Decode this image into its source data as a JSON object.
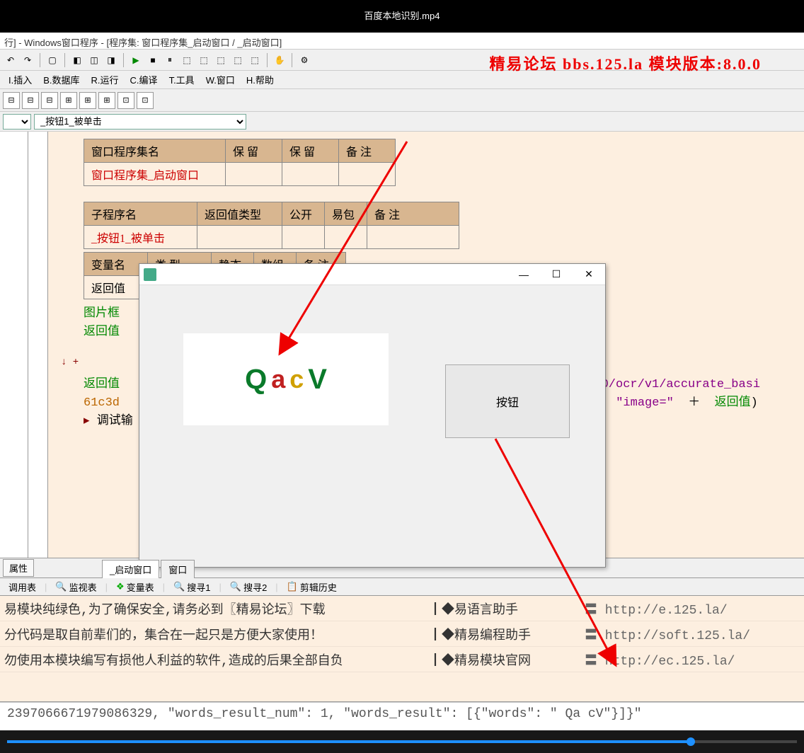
{
  "video_title": "百度本地识别.mp4",
  "window_title": "行] - Windows窗口程序 - [程序集: 窗口程序集_启动窗口 / _启动窗口]",
  "banner": "精易论坛 bbs.125.la 模块版本:8.0.0",
  "menu": {
    "insert": "I.插入",
    "database": "B.数据库",
    "run": "R.运行",
    "compile": "C.编译",
    "tools": "T.工具",
    "window": "W.窗口",
    "help": "H.帮助"
  },
  "dropdown2": "_按钮1_被单击",
  "table1": {
    "h1": "窗口程序集名",
    "h2": "保 留",
    "h3": "保 留",
    "h4": "备 注",
    "r1": "窗口程序集_启动窗口"
  },
  "table2": {
    "h1": "子程序名",
    "h2": "返回值类型",
    "h3": "公开",
    "h4": "易包",
    "h5": "备 注",
    "r1": "_按钮1_被单击"
  },
  "table3": {
    "h1": "变量名",
    "h2": "类 型",
    "h3": "静态",
    "h4": "数组",
    "h5": "备 注",
    "r1": "返回值"
  },
  "code": {
    "l1": "图片框",
    "l2": "返回值",
    "l3a": "返回值",
    "l3b": ".0/ocr/v1/accurate_basi",
    "l4a": "61c3d",
    "l4b": "\"image=\"",
    "l4c": "＋",
    "l4d": "返回值",
    "l5": "调试输"
  },
  "popup": {
    "button_label": "按钮",
    "captcha": {
      "q": "Q",
      "a": "a",
      "c": "c",
      "v": "V"
    },
    "min": "—",
    "max": "☐",
    "close": "✕"
  },
  "prop_tab": "属性",
  "code_tab1": "_启动窗口",
  "code_tab2": "窗口",
  "output_tabs": {
    "t1": "调用表",
    "t2": "监视表",
    "t3": "变量表",
    "t4": "搜寻1",
    "t5": "搜寻2",
    "t6": "剪辑历史"
  },
  "output": {
    "rows": [
      {
        "c1": "易模块纯绿色,为了确保安全,请务必到〖精易论坛〗下载",
        "c2": "┃◆易语言助手",
        "c3": "〓 http://e.125.la/"
      },
      {
        "c1": "分代码是取自前辈们的，集合在一起只是方便大家使用！",
        "c2": "┃◆精易编程助手",
        "c3": "〓 http://soft.125.la/"
      },
      {
        "c1": "勿使用本模块编写有损他人利益的软件,造成的后果全部自负",
        "c2": "┃◆精易模块官网",
        "c3": "〓 http://ec.125.la/"
      }
    ]
  },
  "result_line": " 2397066671979086329, \"words_result_num\": 1, \"words_result\": [{\"words\": \" Qa cV\"}]}\""
}
